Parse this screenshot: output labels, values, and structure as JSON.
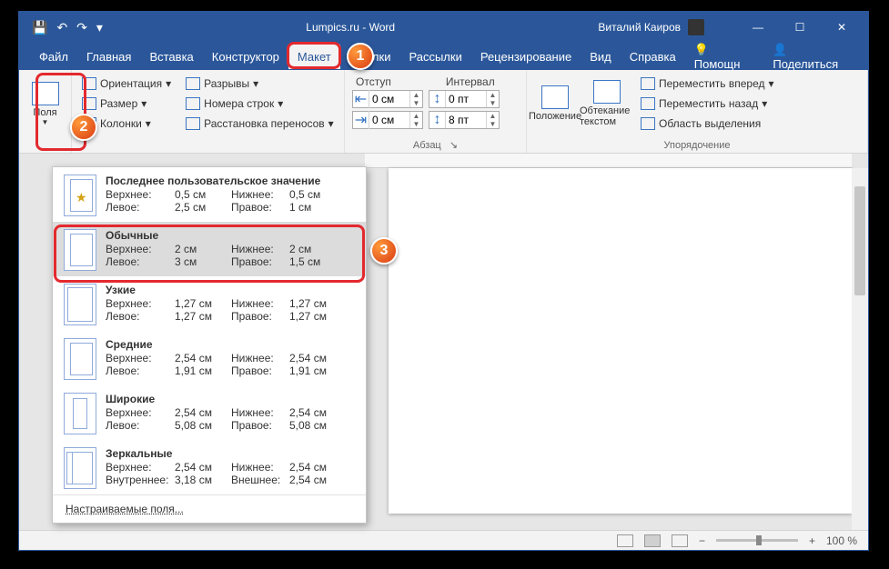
{
  "title": "Lumpics.ru - Word",
  "user": "Виталий Каиров",
  "win": {
    "min": "—",
    "max": "☐",
    "close": "✕"
  },
  "qat": {
    "save": "💾",
    "undo": "↶",
    "redo": "↷",
    "more": "▾"
  },
  "menu": [
    "Файл",
    "Главная",
    "Вставка",
    "Конструктор",
    "Макет",
    "Ссылки",
    "Рассылки",
    "Рецензирование",
    "Вид",
    "Справка"
  ],
  "menu_active": 4,
  "menu_right": {
    "help": "Помощн",
    "share": "Поделиться"
  },
  "ribbon": {
    "margins_btn": "Поля",
    "orient": "Ориентация",
    "size": "Размер",
    "cols": "Колонки",
    "breaks": "Разрывы",
    "lineno": "Номера строк",
    "hyph": "Расстановка переносов",
    "para_label": "Абзац",
    "indent_label": "Отступ",
    "spacing_label": "Интервал",
    "indent_left": "0 см",
    "indent_right": "0 см",
    "spacing_before": "0 пт",
    "spacing_after": "8 пт",
    "position": "Положение",
    "wrap": "Обтекание текстом",
    "bring_fwd": "Переместить вперед",
    "send_back": "Переместить назад",
    "selection": "Область выделения",
    "arrange_label": "Упорядочение"
  },
  "dd": {
    "last": {
      "title": "Последнее пользовательское значение",
      "top": "0,5 см",
      "bottom": "0,5 см",
      "left": "2,5 см",
      "right": "1 см"
    },
    "normal": {
      "title": "Обычные",
      "top": "2 см",
      "bottom": "2 см",
      "left": "3 см",
      "right": "1,5 см"
    },
    "narrow": {
      "title": "Узкие",
      "top": "1,27 см",
      "bottom": "1,27 см",
      "left": "1,27 см",
      "right": "1,27 см"
    },
    "medium": {
      "title": "Средние",
      "top": "2,54 см",
      "bottom": "2,54 см",
      "left": "1,91 см",
      "right": "1,91 см"
    },
    "wide": {
      "title": "Широкие",
      "top": "2,54 см",
      "bottom": "2,54 см",
      "left": "5,08 см",
      "right": "5,08 см"
    },
    "mirror": {
      "title": "Зеркальные",
      "top": "2,54 см",
      "bottom": "2,54 см",
      "inner_l": "Внутреннее:",
      "inner": "3,18 см",
      "outer_l": "Внешнее:",
      "outer": "2,54 см"
    },
    "labels": {
      "top": "Верхнее:",
      "bottom": "Нижнее:",
      "left": "Левое:",
      "right": "Правое:"
    },
    "custom": "Настраиваемые поля..."
  },
  "status": {
    "zoom": "100 %"
  },
  "badges": {
    "b1": "1",
    "b2": "2",
    "b3": "3"
  }
}
